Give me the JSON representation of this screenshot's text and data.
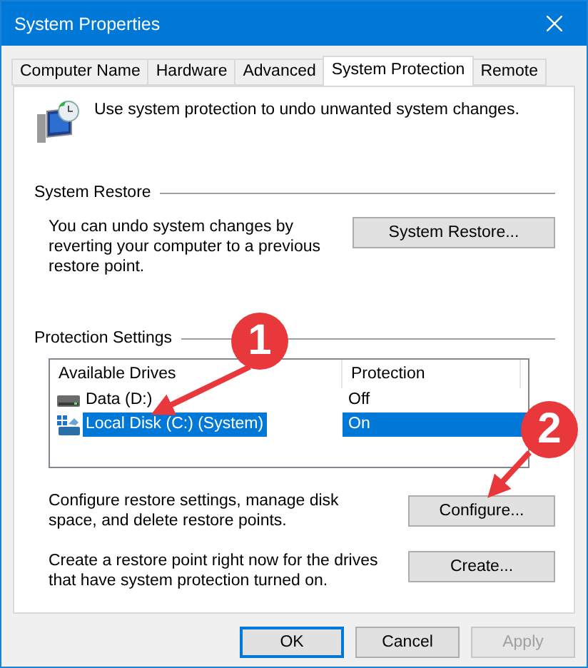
{
  "window": {
    "title": "System Properties"
  },
  "tabs": [
    {
      "label": "Computer Name",
      "selected": false
    },
    {
      "label": "Hardware",
      "selected": false
    },
    {
      "label": "Advanced",
      "selected": false
    },
    {
      "label": "System Protection",
      "selected": true
    },
    {
      "label": "Remote",
      "selected": false
    }
  ],
  "intro": "Use system protection to undo unwanted system changes.",
  "system_restore": {
    "heading": "System Restore",
    "description": "You can undo system changes by reverting your computer to a previous restore point.",
    "button": "System Restore..."
  },
  "protection_settings": {
    "heading": "Protection Settings",
    "columns": [
      "Available Drives",
      "Protection"
    ],
    "drives": [
      {
        "name": "Data (D:)",
        "protection": "Off",
        "kind": "data",
        "selected": false
      },
      {
        "name": "Local Disk (C:) (System)",
        "protection": "On",
        "kind": "system",
        "selected": true
      }
    ],
    "configure": {
      "description": "Configure restore settings, manage disk space, and delete restore points.",
      "button": "Configure..."
    },
    "create": {
      "description": "Create a restore point right now for the drives that have system protection turned on.",
      "button": "Create..."
    }
  },
  "buttons": [
    {
      "label": "OK",
      "default": true,
      "disabled": false
    },
    {
      "label": "Cancel",
      "default": false,
      "disabled": false
    },
    {
      "label": "Apply",
      "default": false,
      "disabled": true
    }
  ],
  "callouts": [
    {
      "number": "1"
    },
    {
      "number": "2"
    }
  ]
}
